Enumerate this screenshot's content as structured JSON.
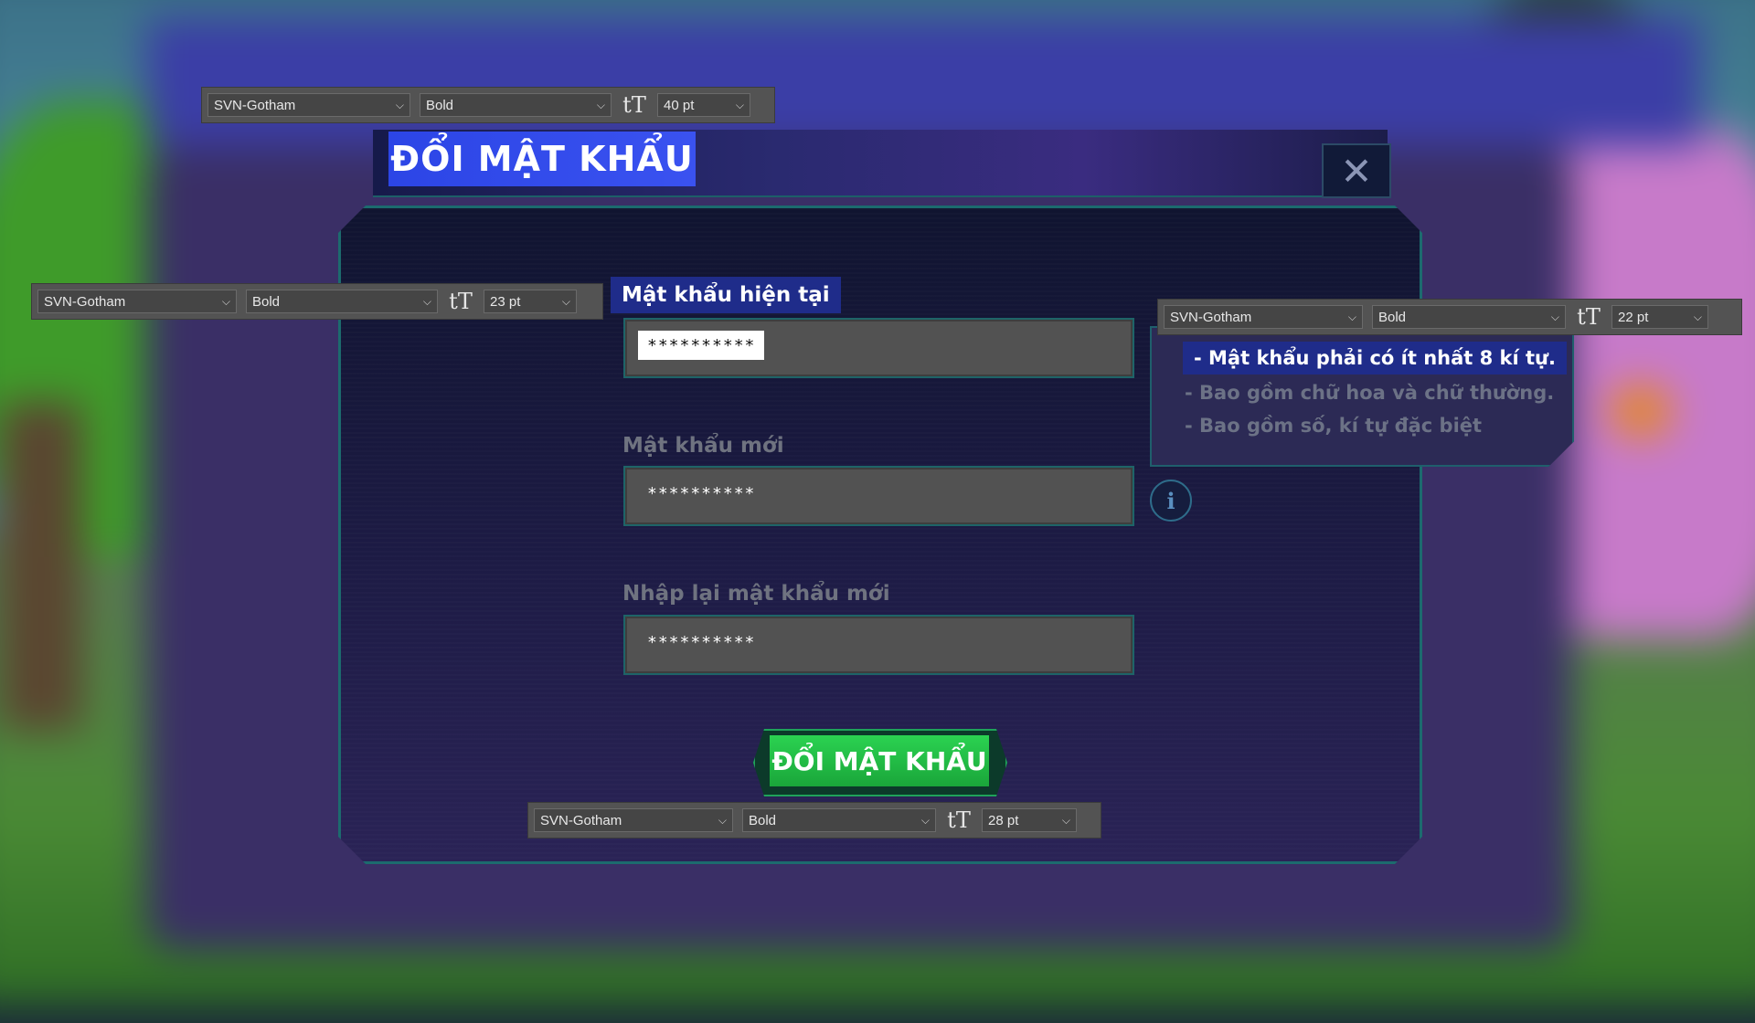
{
  "dialog": {
    "title": "ĐỔI MẬT KHẨU",
    "close_glyph": "✕",
    "submit_label": "ĐỔI MẬT KHẨU"
  },
  "fields": [
    {
      "label": "Mật khẩu hiện tại",
      "value": "**********",
      "state": "active"
    },
    {
      "label": "Mật khẩu mới",
      "value": "**********",
      "state": "idle"
    },
    {
      "label": "Nhập lại mật khẩu mới",
      "value": "**********",
      "state": "idle"
    }
  ],
  "requirements": {
    "items": [
      "- Mật khẩu phải có ít nhất 8 kí tự.",
      "- Bao gồm chữ hoa và chữ thường.",
      "- Bao gồm số, kí tự đặc biệt"
    ],
    "info_glyph": "i"
  },
  "toolbars": [
    {
      "id": "title",
      "font": "SVN-Gotham",
      "weight": "Bold",
      "size": "40 pt"
    },
    {
      "id": "labels",
      "font": "SVN-Gotham",
      "weight": "Bold",
      "size": "23 pt"
    },
    {
      "id": "requirements",
      "font": "SVN-Gotham",
      "weight": "Bold",
      "size": "22 pt"
    },
    {
      "id": "button",
      "font": "SVN-Gotham",
      "weight": "Bold",
      "size": "28 pt"
    }
  ],
  "icons": {
    "text_size": "tT",
    "chevron": "⌵"
  },
  "colors": {
    "active_highlight": "#1f2c8a",
    "submit_green": "#22c04a",
    "title_blue": "#2c45e6",
    "frame_teal": "#1c6b6e"
  }
}
